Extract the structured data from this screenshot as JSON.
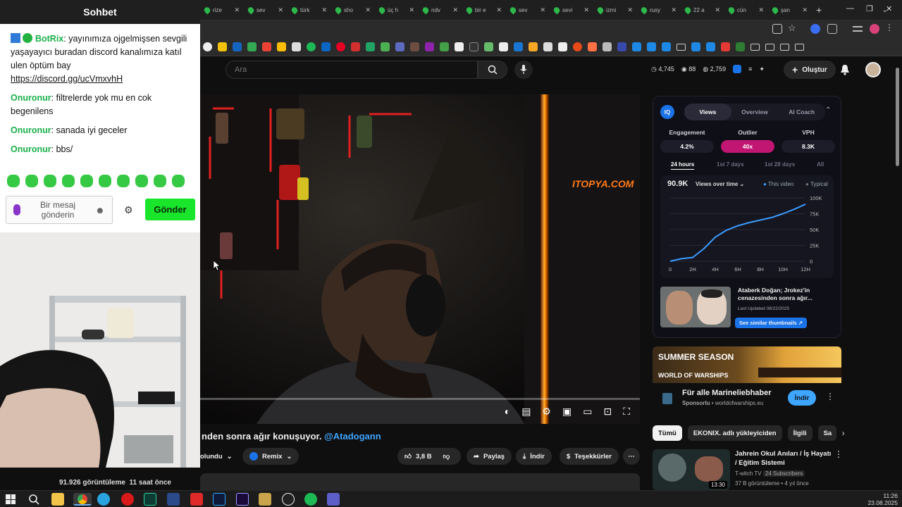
{
  "browser": {
    "tabs": [
      {
        "label": "rize"
      },
      {
        "label": "sev"
      },
      {
        "label": "türk"
      },
      {
        "label": "sho"
      },
      {
        "label": "üç h"
      },
      {
        "label": "ndv"
      },
      {
        "label": "bir e"
      },
      {
        "label": "sev"
      },
      {
        "label": "sevi"
      },
      {
        "label": "izmi"
      },
      {
        "label": "rusy"
      },
      {
        "label": "22 a"
      },
      {
        "label": "cün"
      },
      {
        "label": "şan"
      }
    ],
    "new_tab": "+",
    "colors": {
      "tab_favicon": "#2eb84a",
      "chrome_bg": "#1f1f1f"
    }
  },
  "youtube": {
    "search_placeholder": "Ara",
    "stats": {
      "views": "4,745",
      "comments": "88",
      "likes": "2,759"
    },
    "create_label": "Oluştur",
    "video": {
      "title_partial": "nden sonra ağır konuşuyor. ",
      "mention": "@Atadogann",
      "watermark": "ITOPYA.COM",
      "likes": "3,8 B",
      "share": "Paylaş",
      "download": "İndir",
      "thanks": "Teşekkürler",
      "remix": "Remix",
      "subscribe_partial": "olundu",
      "views_text": "91.926 görüntüleme",
      "time_text": "11 saat önce"
    },
    "vidiq": {
      "tabs": [
        {
          "label": "Views"
        },
        {
          "label": "Overview"
        },
        {
          "label": "AI Coach"
        }
      ],
      "metrics": [
        {
          "label": "Engagement",
          "value": "4.2%"
        },
        {
          "label": "Outlier",
          "value": "40x"
        },
        {
          "label": "VPH",
          "value": "8.3K"
        }
      ],
      "ranges": [
        {
          "label": "24 hours"
        },
        {
          "label": "1st 7 days"
        },
        {
          "label": "1st 28 days"
        },
        {
          "label": "All"
        }
      ],
      "chart_value": "90.9K",
      "chart_selector": "Views over time",
      "legend_this": "This video",
      "legend_typical": "Typical",
      "y_ticks": [
        "100K",
        "75K",
        "50K",
        "25K",
        "0"
      ],
      "x_ticks": [
        "0",
        "2H",
        "4H",
        "6H",
        "8H",
        "10H",
        "12H"
      ],
      "curve": [
        {
          "h": 0,
          "v": 0
        },
        {
          "h": 1,
          "v": 4
        },
        {
          "h": 2,
          "v": 6
        },
        {
          "h": 3,
          "v": 20
        },
        {
          "h": 4,
          "v": 38
        },
        {
          "h": 5,
          "v": 49
        },
        {
          "h": 6,
          "v": 56
        },
        {
          "h": 7,
          "v": 61
        },
        {
          "h": 8,
          "v": 65
        },
        {
          "h": 9,
          "v": 69
        },
        {
          "h": 10,
          "v": 75
        },
        {
          "h": 11,
          "v": 82
        },
        {
          "h": 12,
          "v": 90
        }
      ],
      "thumb_title": "Ataberk Doğan; Jrokez'in cenazesinden sonra ağır...",
      "thumb_updated": "Last Updated 08/22/2025",
      "thumb_button": "See similar thumbnails ↗",
      "colors": {
        "accent": "#1a73e8",
        "outlier": "#c21673",
        "line": "#3b9cff"
      }
    },
    "ad": {
      "banner_title": "SUMMER SEASON",
      "banner_brand": "WORLD OF WARSHIPS",
      "title": "Für alle Marineliebhaber",
      "sponsor": "Sponsorlu",
      "domain": "worldofwarships.eu",
      "cta": "İndir"
    },
    "chips": [
      {
        "label": "Tümü"
      },
      {
        "label": "EKONIX. adlı yükleyiciden"
      },
      {
        "label": "İlgili"
      },
      {
        "label": "Sa"
      }
    ],
    "recommendation": {
      "title": "Jahrein Okul Anıları / İş Hayatı / Eğitim Sistemi",
      "channel": "T-witch TV",
      "subs": "24 Subscribers",
      "meta": "37 B görüntüleme • 4 yıl önce",
      "duration": "13:30"
    }
  },
  "chat": {
    "header": "Sohbet",
    "messages": [
      {
        "user": "BotRix",
        "text": "yayınımıza ojgelmişsen sevgili yaşayayıcı buradan discord kanalımıza katıl ulen öptüm bay",
        "link": "https://discord.gg/ucVmxvhH"
      },
      {
        "user": "Onuronur",
        "text": "filtrelerde yok mu en cok begenilens"
      },
      {
        "user": "Onuronur",
        "text": "sanada iyi geceler"
      },
      {
        "user": "Onuronur",
        "text": "bbs/"
      }
    ],
    "input_placeholder": "Bir mesaj gönderin",
    "send_label": "Gönder",
    "colors": {
      "send": "#19e52a",
      "username": "#1ab04a"
    }
  },
  "taskbar": {
    "time": "11:26",
    "date": "23.08.2025"
  }
}
